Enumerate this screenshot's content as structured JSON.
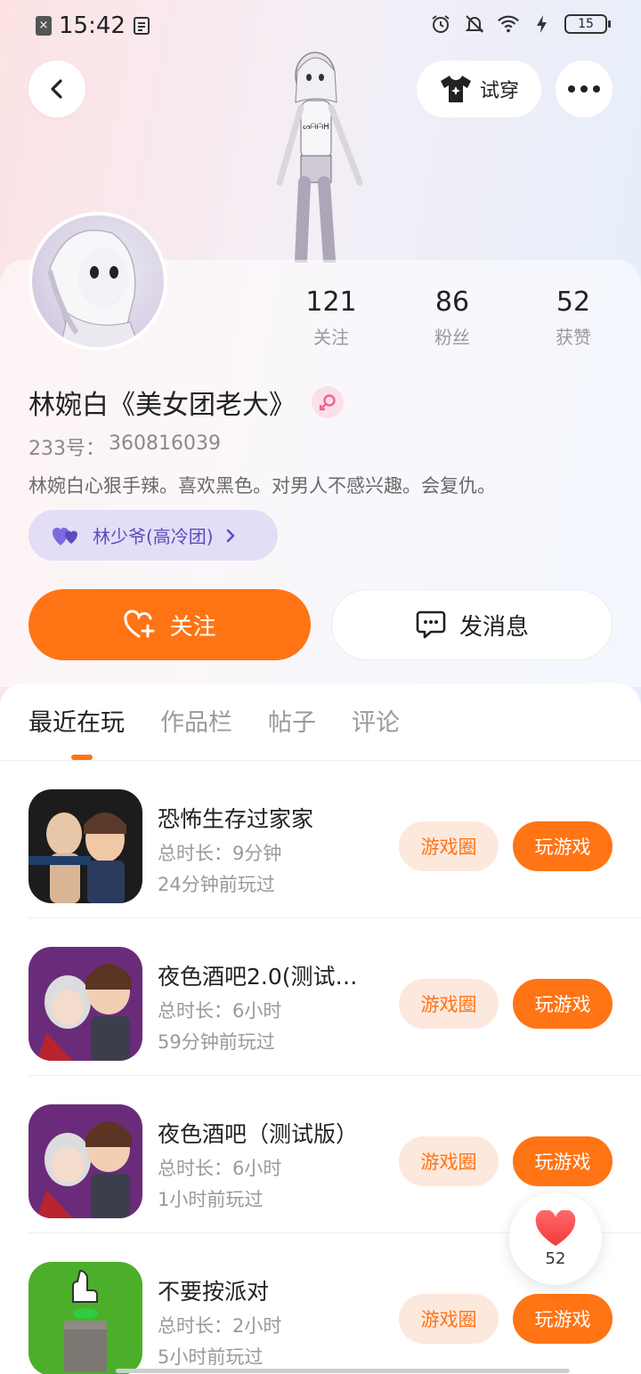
{
  "status_bar": {
    "time": "15:42",
    "battery": "15"
  },
  "header": {
    "try_on_label": "试穿"
  },
  "profile": {
    "stats": [
      {
        "value": "121",
        "label": "关注"
      },
      {
        "value": "86",
        "label": "粉丝"
      },
      {
        "value": "52",
        "label": "获赞"
      }
    ],
    "name": "林婉白《美女团老大》",
    "uid_label": "233号：",
    "uid_value": "360816039",
    "bio": "林婉白心狠手辣。喜欢黑色。对男人不感兴趣。会复仇。",
    "group_tag": "林少爷(高冷团)",
    "follow_label": "关注",
    "message_label": "发消息"
  },
  "tabs": [
    "最近在玩",
    "作品栏",
    "帖子",
    "评论"
  ],
  "games": [
    {
      "title": "恐怖生存过家家",
      "duration": "总时长：9分钟",
      "last_played": "24分钟前玩过"
    },
    {
      "title": "夜色酒吧2.0(测试…",
      "duration": "总时长：6小时",
      "last_played": "59分钟前玩过"
    },
    {
      "title": "夜色酒吧（测试版）",
      "duration": "总时长：6小时",
      "last_played": "1小时前玩过"
    },
    {
      "title": "不要按派对",
      "duration": "总时长：2小时",
      "last_played": "5小时前玩过"
    }
  ],
  "game_buttons": {
    "circle": "游戏圈",
    "play": "玩游戏"
  },
  "like_fab": {
    "count": "52"
  },
  "colors": {
    "accent": "#ff7414",
    "accent_light": "#fde8dd",
    "tag_bg": "#e4ddf6",
    "tag_text": "#5b4bbf"
  }
}
